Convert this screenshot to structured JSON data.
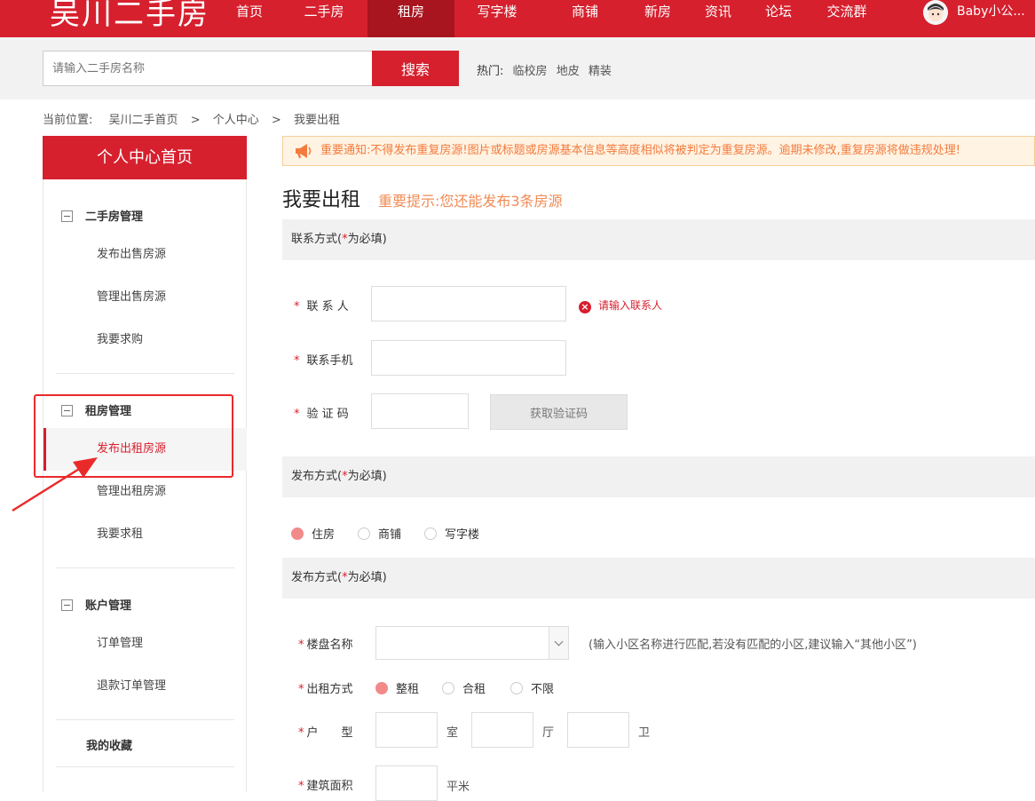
{
  "header": {
    "logo": "吴川二手房",
    "nav": [
      "首页",
      "二手房",
      "租房",
      "写字楼",
      "商铺",
      "新房",
      "资讯",
      "论坛",
      "交流群"
    ],
    "active_nav": "租房",
    "user": "Baby小公..."
  },
  "search": {
    "placeholder": "请输入二手房名称",
    "button": "搜索",
    "hot_label": "热门:",
    "hot_links": [
      "临校房",
      "地皮",
      "精装"
    ]
  },
  "breadcrumb": {
    "label": "当前位置:",
    "items": [
      "吴川二手首页",
      "个人中心",
      "我要出租"
    ],
    "separator": ">"
  },
  "sidebar": {
    "title": "个人中心首页",
    "groups": [
      {
        "title": "二手房管理",
        "items": [
          "发布出售房源",
          "管理出售房源",
          "我要求购"
        ]
      },
      {
        "title": "租房管理",
        "items": [
          "发布出租房源",
          "管理出租房源",
          "我要求租"
        ]
      },
      {
        "title": "账户管理",
        "items": [
          "订单管理",
          "退款订单管理"
        ]
      }
    ],
    "favorites": "我的收藏",
    "active_item": "发布出租房源"
  },
  "notice": "重要通知:不得发布重复房源!图片或标题或房源基本信息等高度相似将被判定为重复房源。逾期未修改,重复房源将做违规处理!",
  "page": {
    "title": "我要出租",
    "tip": "重要提示:您还能发布3条房源"
  },
  "contact": {
    "section": "联系方式",
    "required_note_open": "(",
    "required_mark": "*",
    "required_note_close": "为必填)",
    "name_label": "联 系 人",
    "name_error": "请输入联系人",
    "phone_label": "联系手机",
    "code_label": "验 证 码",
    "code_button": "获取验证码"
  },
  "publish_type": {
    "section": "发布方式",
    "options": [
      "住房",
      "商铺",
      "写字楼"
    ],
    "selected": "住房"
  },
  "details": {
    "section": "发布方式",
    "estate_label": "楼盘名称",
    "estate_hint": "(输入小区名称进行匹配,若没有匹配的小区,建议输入“其他小区”)",
    "rent_label": "出租方式",
    "rent_options": [
      "整租",
      "合租",
      "不限"
    ],
    "rent_selected": "整租",
    "layout_label": "户　　型",
    "layout_units": [
      "室",
      "厅",
      "卫"
    ],
    "area_label": "建筑面积",
    "area_unit": "平米"
  },
  "colors": {
    "brand_red": "#d6202e",
    "notice_orange": "#f47b3d",
    "radio_selected": "#f28a8a"
  }
}
